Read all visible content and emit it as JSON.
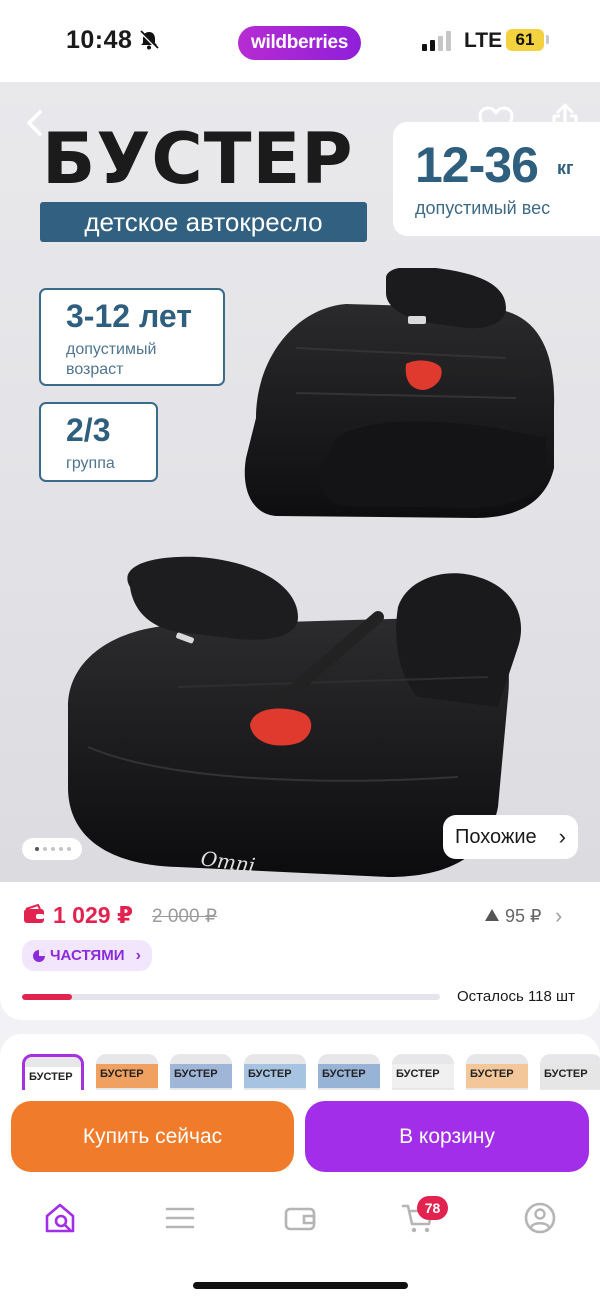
{
  "status_bar": {
    "time": "10:48",
    "app_pill": "wildberries",
    "network": "LTE",
    "battery": "61",
    "icons": [
      "bell-muted-icon",
      "signal-icon",
      "battery-icon"
    ]
  },
  "hero": {
    "title": "БУСТЕР",
    "subtitle": "детское автокресло",
    "weight": {
      "value": "12-36",
      "unit": "кг",
      "caption": "допустимый вес"
    },
    "age": {
      "value": "3-12 лет",
      "caption": "допустимый возраст"
    },
    "group": {
      "value": "2/3",
      "caption": "группа"
    },
    "brand_mark": "Omni",
    "carousel": {
      "total": 5,
      "active": 1
    },
    "similar_label": "Похожие",
    "icons": [
      "back-icon",
      "heart-icon",
      "share-icon"
    ],
    "colors": {
      "seat": "#1c1c1e",
      "buckle": "#e03a2e",
      "box_border": "#3a6b8a",
      "box_text": "#2f5f7e"
    }
  },
  "price": {
    "current": "1 029 ₽",
    "old": "2 000 ₽",
    "change": "95 ₽",
    "parts_label": "ЧАСТЯМИ",
    "stock_label": "Осталось 118 шт",
    "stock_fraction": 0.12,
    "colors": {
      "accent": "#e3234f",
      "parts": "#8b2bd9"
    }
  },
  "thumbnails": [
    {
      "title": "БУСТЕР",
      "color": "#ffffff",
      "active": true
    },
    {
      "title": "БУСТЕР",
      "color": "#f0a060",
      "active": false
    },
    {
      "title": "БУСТЕР",
      "color": "#9fb6d8",
      "active": false
    },
    {
      "title": "БУСТЕР",
      "color": "#a6c4e2",
      "active": false
    },
    {
      "title": "БУСТЕР",
      "color": "#97b3d6",
      "active": false
    },
    {
      "title": "БУСТЕР",
      "color": "#f0f0f0",
      "active": false
    },
    {
      "title": "БУСТЕР",
      "color": "#f3c79a",
      "active": false
    },
    {
      "title": "БУСТЕР",
      "color": "#e6e6e6",
      "active": false
    }
  ],
  "actions": {
    "buy_now": "Купить сейчас",
    "add_to_cart": "В корзину",
    "colors": {
      "buy_now": "#f07b2a",
      "add_to_cart": "#a32ee9"
    }
  },
  "tab_bar": {
    "items": [
      "home-search-icon",
      "catalog-menu-icon",
      "wallet-icon",
      "cart-icon",
      "profile-icon"
    ],
    "cart_count": "78",
    "active": "home-search-icon"
  }
}
